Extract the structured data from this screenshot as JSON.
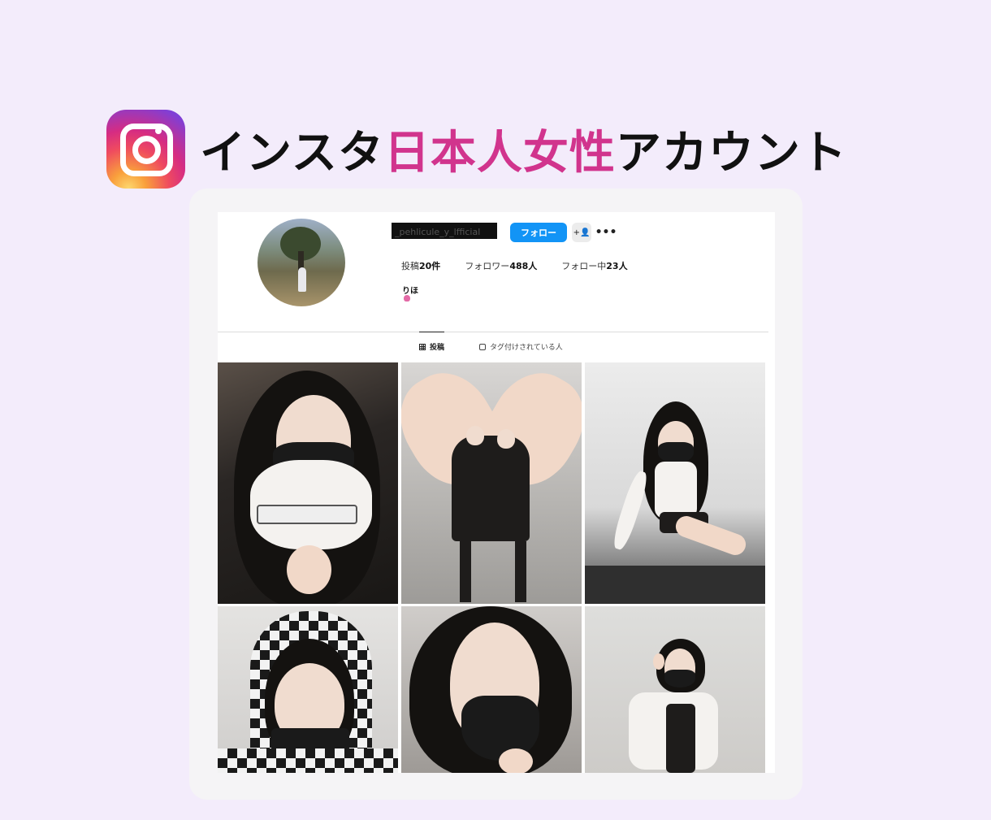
{
  "heading": {
    "prefix": "インスタ",
    "highlight": "日本人女性",
    "suffix": "アカウント",
    "highlight_color": "#d1348d"
  },
  "brand_icon": "instagram-icon",
  "profile": {
    "username": "_pehlicule_y_lfficial",
    "follow_label": "フォロー",
    "add_icon": "person-add-icon",
    "more_icon": "more-dots-icon",
    "more_text": "•••",
    "stats": {
      "posts_label": "投稿",
      "posts_value": "20件",
      "followers_label": "フォロワー",
      "followers_value": "488人",
      "following_label": "フォロー中",
      "following_value": "23人"
    },
    "bio_name": "りほ",
    "accent_color": "#1294f6"
  },
  "tabs": {
    "posts": "投稿",
    "tagged": "タグ付けされている人"
  },
  "grid": {
    "count": 6
  }
}
